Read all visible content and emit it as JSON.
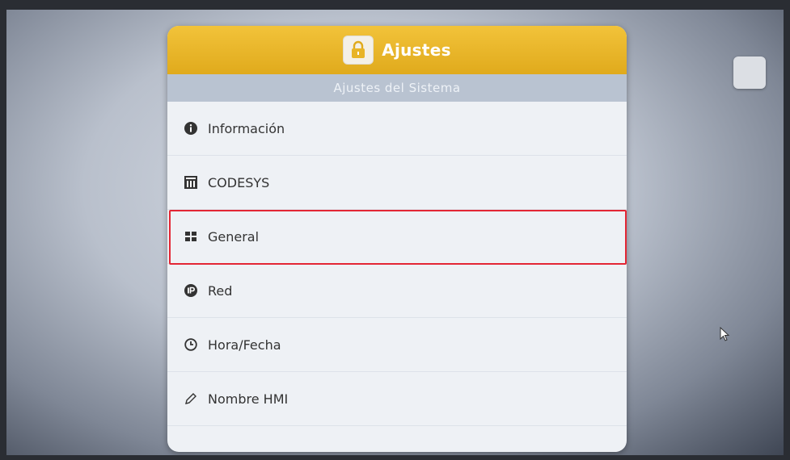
{
  "header": {
    "title": "Ajustes",
    "subtitle": "Ajustes del Sistema"
  },
  "menu": {
    "items": [
      {
        "label": "Información",
        "icon": "info-icon"
      },
      {
        "label": "CODESYS",
        "icon": "codesys-icon"
      },
      {
        "label": "General",
        "icon": "grid-icon"
      },
      {
        "label": "Red",
        "icon": "ip-icon"
      },
      {
        "label": "Hora/Fecha",
        "icon": "clock-icon"
      },
      {
        "label": "Nombre HMI",
        "icon": "pencil-icon"
      }
    ],
    "highlighted_index": 2
  },
  "colors": {
    "header": "#e8b427",
    "subheader": "#b9c3d1",
    "highlight_border": "#e32634"
  }
}
